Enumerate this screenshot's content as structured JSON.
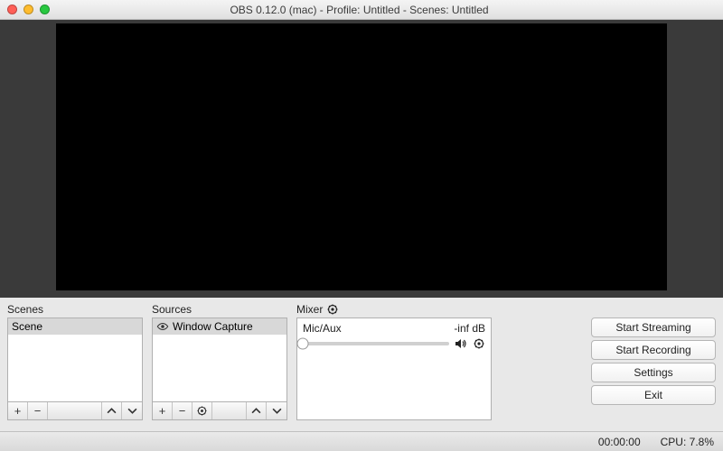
{
  "title": "OBS 0.12.0 (mac) - Profile: Untitled - Scenes: Untitled",
  "scenes": {
    "label": "Scenes",
    "items": [
      "Scene"
    ]
  },
  "sources": {
    "label": "Sources",
    "items": [
      "Window Capture"
    ]
  },
  "mixer": {
    "label": "Mixer",
    "channel": "Mic/Aux",
    "level": "-inf dB"
  },
  "buttons": {
    "start_streaming": "Start Streaming",
    "start_recording": "Start Recording",
    "settings": "Settings",
    "exit": "Exit"
  },
  "status": {
    "time": "00:00:00",
    "cpu": "CPU: 7.8%"
  }
}
